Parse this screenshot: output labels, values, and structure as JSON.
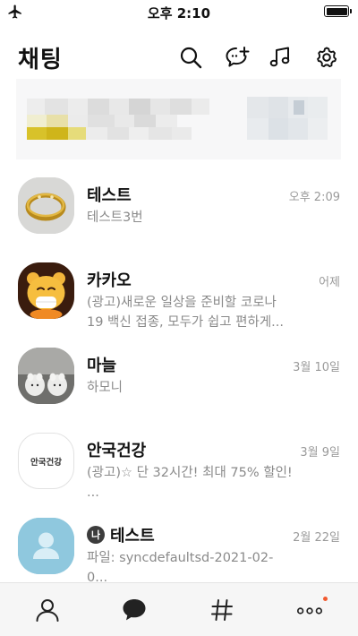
{
  "status_bar": {
    "time": "오후 2:10"
  },
  "header": {
    "title": "채팅",
    "icons": [
      "search-icon",
      "new-chat-icon",
      "music-icon",
      "settings-icon"
    ]
  },
  "banner": {
    "state": "blurred advertisement"
  },
  "chats": [
    {
      "name": "테스트",
      "preview": "테스트3번",
      "time": "오후 2:09",
      "avatar": "ring-photo"
    },
    {
      "name": "카카오",
      "preview": "(광고)새로운 일상을 준비할 코로나 19 백신 접종, 모두가 쉽고 편하게...",
      "time": "어제",
      "avatar": "kakao-character"
    },
    {
      "name": "마늘",
      "preview": "하모니",
      "time": "3월 10일",
      "avatar": "slippers-photo"
    },
    {
      "name": "안국건강",
      "preview": "(광고)☆ 단 32시간! 최대 75% 할인! ...",
      "time": "3월 9일",
      "avatar": "brand-logo",
      "avatar_text": "안국건강"
    },
    {
      "name": "테스트",
      "badge": "나",
      "preview": "파일: syncdefaultsd-2021-02-0...",
      "time": "2월 22일",
      "avatar": "default-profile"
    }
  ],
  "tab_bar": {
    "items": [
      "friends-icon",
      "chat-icon",
      "hashtag-icon",
      "more-icon"
    ],
    "active": "chat-icon",
    "notification_dot_color": "#f25a30"
  }
}
